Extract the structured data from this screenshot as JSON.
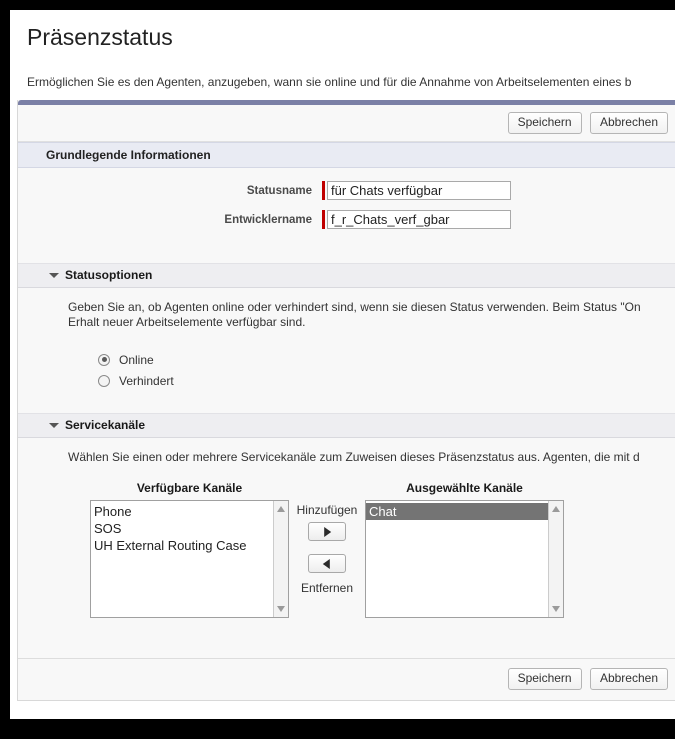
{
  "page": {
    "title": "Präsenzstatus",
    "description": "Ermöglichen Sie es den Agenten, anzugeben, wann sie online und für die Annahme von Arbeitselementen eines b"
  },
  "toolbar": {
    "save_label": "Speichern",
    "cancel_label": "Abbrechen"
  },
  "basic_info": {
    "header": "Grundlegende Informationen",
    "fields": [
      {
        "label": "Statusname",
        "value": "für Chats verfügbar",
        "required": true
      },
      {
        "label": "Entwicklername",
        "value": "f_r_Chats_verf_gbar",
        "required": true
      }
    ]
  },
  "status_options": {
    "header": "Statusoptionen",
    "toggle_icon": "chevron-down-icon",
    "description_line1": "Geben Sie an, ob Agenten online oder verhindert sind, wenn sie diesen Status verwenden. Beim Status \"On",
    "description_line2": "Erhalt neuer Arbeitselemente verfügbar sind.",
    "options": [
      {
        "label": "Online",
        "selected": true
      },
      {
        "label": "Verhindert",
        "selected": false
      }
    ]
  },
  "service_channels": {
    "header": "Servicekanäle",
    "toggle_icon": "chevron-down-icon",
    "description": "Wählen Sie einen oder mehrere Servicekanäle zum Zuweisen dieses Präsenzstatus aus. Agenten, die mit d",
    "available_title": "Verfügbare Kanäle",
    "available_items": [
      "Phone",
      "SOS",
      "UH External Routing Case"
    ],
    "selected_title": "Ausgewählte Kanäle",
    "selected_items": [
      {
        "label": "Chat",
        "highlighted": true
      }
    ],
    "add_label": "Hinzufügen",
    "remove_label": "Entfernen",
    "add_icon": "arrow-right-icon",
    "remove_icon": "arrow-left-icon",
    "scroll_up_icon": "triangle-up-icon",
    "scroll_down_icon": "triangle-down-icon"
  },
  "colors": {
    "accent_bar": "#7b80a6",
    "section_header_bg": "#e9ebf3",
    "required_marker": "#c00000",
    "selection_bg": "#747474"
  }
}
